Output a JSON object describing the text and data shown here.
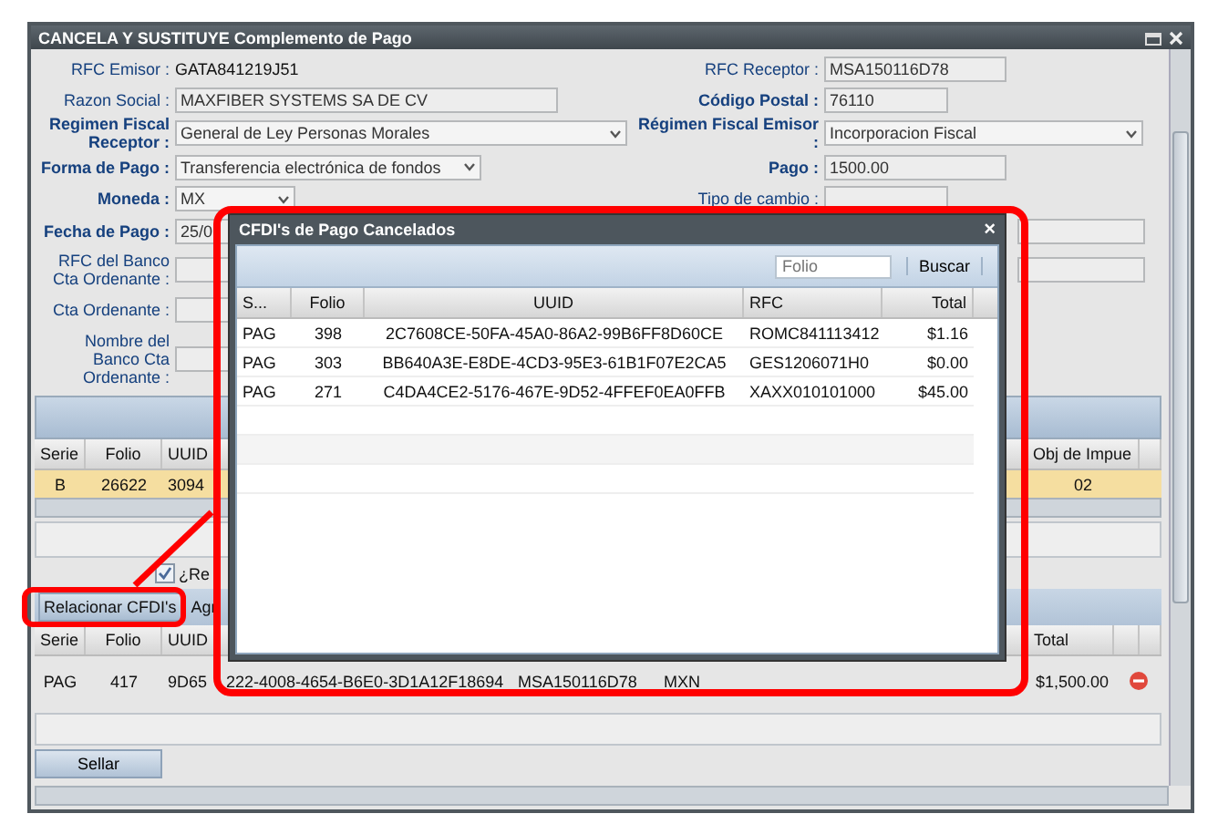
{
  "window": {
    "title": "CANCELA Y SUSTITUYE Complemento de Pago"
  },
  "form": {
    "rows": [
      {
        "left": {
          "label": "RFC Emisor :",
          "bold": false,
          "kind": "text",
          "value": "GATA841219J51"
        },
        "right": {
          "label": "RFC Receptor :",
          "bold": false,
          "kind": "input",
          "value": "MSA150116D78"
        }
      },
      {
        "left": {
          "label": "Razon Social :",
          "bold": false,
          "kind": "input",
          "value": "MAXFIBER SYSTEMS SA DE CV"
        },
        "right": {
          "label": "Código Postal :",
          "bold": true,
          "kind": "input",
          "value": "76110"
        }
      },
      {
        "left": {
          "label": "Regimen Fiscal Receptor :",
          "bold": true,
          "kind": "select",
          "value": "General de Ley Personas Morales"
        },
        "right": {
          "label": "Régimen Fiscal Emisor :",
          "bold": true,
          "kind": "select",
          "value": "Incorporacion Fiscal"
        }
      },
      {
        "left": {
          "label": "Forma de Pago :",
          "bold": true,
          "kind": "select",
          "value": "Transferencia electrónica de fondos"
        },
        "right": {
          "label": "Pago :",
          "bold": true,
          "kind": "input",
          "value": "1500.00"
        }
      },
      {
        "left": {
          "label": "Moneda :",
          "bold": true,
          "kind": "select",
          "value": "MX"
        },
        "right": {
          "label": "Tipo de cambio :",
          "bold": false,
          "kind": "input"
        }
      },
      {
        "left": {
          "label": "Fecha de Pago :",
          "bold": true,
          "kind": "input",
          "value": "25/0"
        },
        "right": {
          "kind": "input"
        }
      },
      {
        "left": {
          "label": "RFC del Banco Cta Ordenante :",
          "bold": false,
          "kind": "input"
        },
        "right": {
          "kind": "input"
        }
      },
      {
        "left": {
          "label": "Cta Ordenante :",
          "bold": false,
          "kind": "input"
        },
        "right": {
          "kind": "empty"
        }
      },
      {
        "left": {
          "label": "Nombre del Banco Cta Ordenante :",
          "bold": false,
          "kind": "input"
        },
        "right": {
          "kind": "empty"
        }
      }
    ]
  },
  "payments_grid": {
    "columns": [
      "Serie",
      "Folio",
      "UUID",
      "Obj de Impue"
    ],
    "rows": [
      {
        "cells": [
          "B",
          "26622",
          "3094",
          "02"
        ],
        "selected": true
      }
    ]
  },
  "relate_checkbox": {
    "label": "¿Re",
    "checked": true
  },
  "toolbar": {
    "buttons": [
      {
        "label": "Relacionar CFDI's"
      },
      {
        "label": "Agr"
      }
    ]
  },
  "related_grid": {
    "columns": [
      "Serie",
      "Folio",
      "UUID",
      null,
      null,
      null,
      "Total"
    ],
    "rows": [
      {
        "cells": [
          "PAG",
          "417",
          "9D65",
          "222-4008-4654-B6E0-3D1A12F18694",
          "MSA150116D78",
          "MXN",
          "$1,500.00"
        ]
      }
    ]
  },
  "footer_button": "Sellar",
  "dialog": {
    "title": "CFDI's de Pago Cancelados",
    "close": "×",
    "search": {
      "placeholder": "Folio"
    },
    "search_button": "Buscar",
    "columns": [
      "S...",
      "Folio",
      "UUID",
      "RFC",
      "Total"
    ],
    "rows": [
      {
        "cells": [
          "PAG",
          "398",
          "2C7608CE-50FA-45A0-86A2-99B6FF8D60CE",
          "ROMC841113412",
          "$1.16"
        ]
      },
      {
        "cells": [
          "PAG",
          "303",
          "BB640A3E-E8DE-4CD3-95E3-61B1F07E2CA5",
          "GES1206071H0",
          "$0.00"
        ]
      },
      {
        "cells": [
          "PAG",
          "271",
          "C4DA4CE2-5176-467E-9D52-4FFEF0EA0FFB",
          "XAXX010101000",
          "$45.00"
        ]
      }
    ]
  }
}
